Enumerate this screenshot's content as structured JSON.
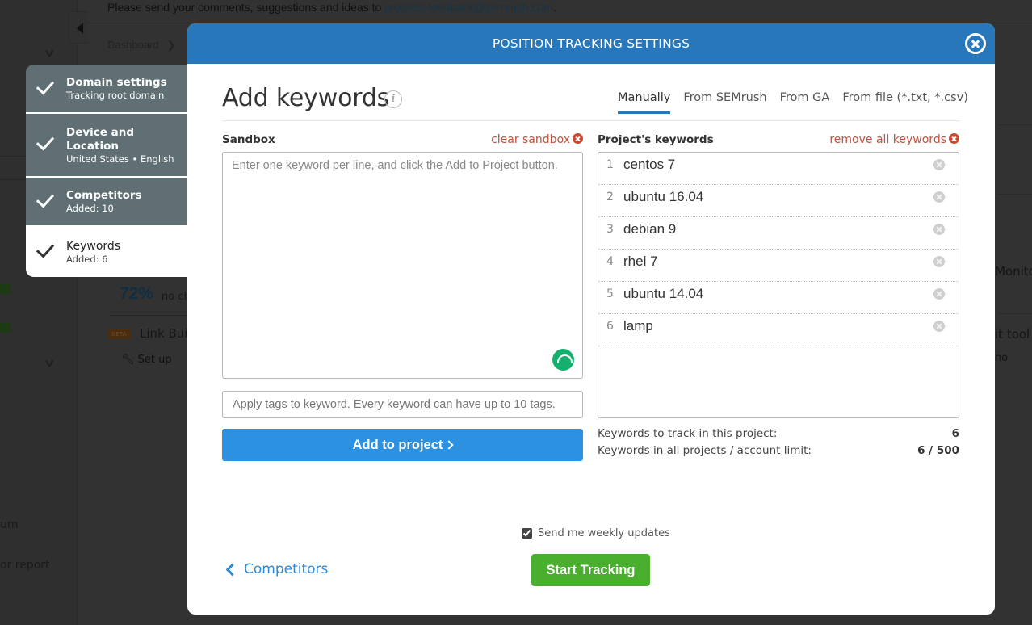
{
  "background": {
    "notice_text": "Please send your comments, suggestions and ideas to ",
    "notice_link": "projects-feedback@semrush.com",
    "notice_end": ".",
    "breadcrumb": "Dashboard",
    "percent_value": "72%",
    "percent_sub": "no ch",
    "beta_badge": "BETA",
    "link_building": "Link Buil",
    "setup": "Set up",
    "side_text_1": "um",
    "side_text_2": "or report",
    "right_text_1": "Monito",
    "right_text_2": "it tool",
    "right_text_3": "no"
  },
  "steps": [
    {
      "title": "Domain settings",
      "subtitle": "Tracking root domain",
      "completed": true,
      "active": false
    },
    {
      "title": "Device and Location",
      "subtitle": "United States • English",
      "completed": true,
      "active": false
    },
    {
      "title": "Competitors",
      "subtitle": "Added: 10",
      "completed": true,
      "active": false
    },
    {
      "title": "Keywords",
      "subtitle": "Added: 6",
      "completed": true,
      "active": true
    }
  ],
  "modal": {
    "header_title": "POSITION TRACKING SETTINGS",
    "page_title": "Add keywords",
    "tabs": [
      {
        "label": "Manually",
        "active": true
      },
      {
        "label": "From SEMrush",
        "active": false
      },
      {
        "label": "From GA",
        "active": false
      },
      {
        "label": "From file (*.txt, *.csv)",
        "active": false
      }
    ],
    "sandbox": {
      "label": "Sandbox",
      "clear_label": "clear sandbox",
      "placeholder": "Enter one keyword per line, and click the Add to Project button.",
      "value": ""
    },
    "tags_input": {
      "placeholder": "Apply tags to keyword. Every keyword can have up to 10 tags.",
      "value": ""
    },
    "add_button_label": "Add to project",
    "project_keywords": {
      "label": "Project's keywords",
      "remove_all_label": "remove all keywords",
      "items": [
        {
          "num": "1",
          "keyword": "centos 7"
        },
        {
          "num": "2",
          "keyword": "ubuntu 16.04"
        },
        {
          "num": "3",
          "keyword": "debian 9"
        },
        {
          "num": "4",
          "keyword": "rhel 7"
        },
        {
          "num": "5",
          "keyword": "ubuntu 14.04"
        },
        {
          "num": "6",
          "keyword": "lamp"
        }
      ]
    },
    "stats": {
      "track_label": "Keywords to track in this project:",
      "track_value": "6",
      "limit_label": "Keywords in all projects / account limit:",
      "limit_value": "6 / 500"
    },
    "weekly_updates_label": "Send me weekly updates",
    "weekly_updates_checked": true,
    "back_label": "Competitors",
    "start_label": "Start Tracking"
  },
  "colors": {
    "header_blue": "#2877bb",
    "primary_button": "#2c91e0",
    "start_green": "#4aae2f",
    "danger_red": "#c0533d",
    "step_gray": "#5f6f73"
  }
}
